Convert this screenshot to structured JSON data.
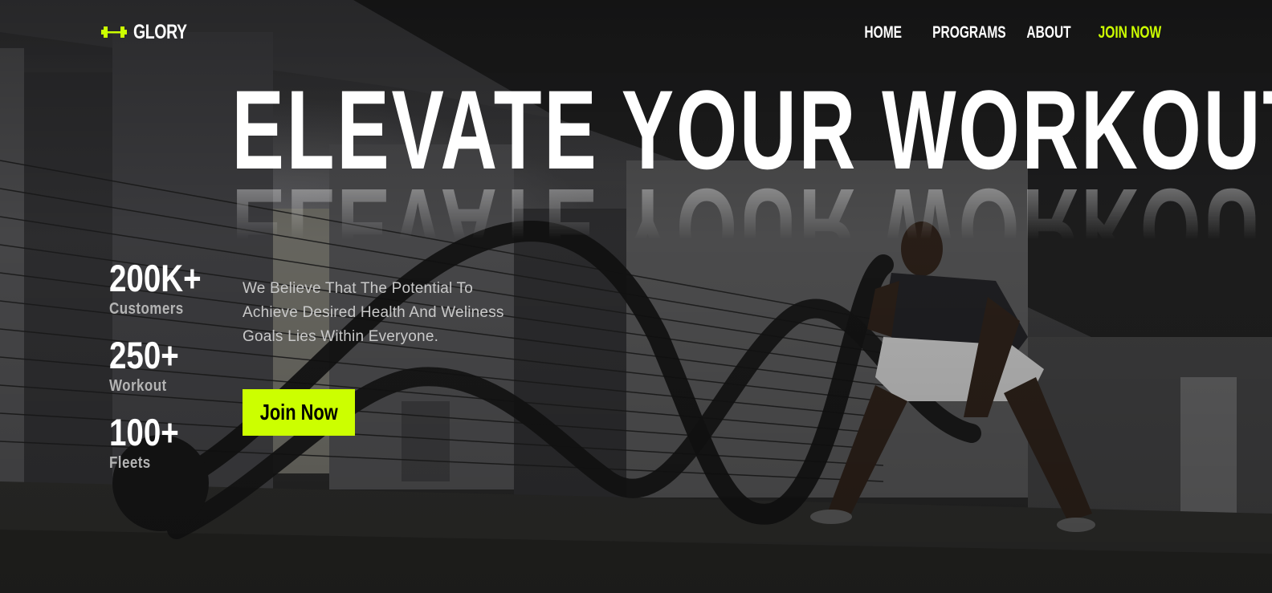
{
  "brand": {
    "name": "GLORY",
    "icon": "dumbbell-icon",
    "accent_color": "#ccff00"
  },
  "nav": {
    "items": [
      {
        "label": "HOME"
      },
      {
        "label": "PROGRAMS"
      },
      {
        "label": "ABOUT"
      },
      {
        "label": "JOIN NOW",
        "accent": true
      }
    ]
  },
  "hero": {
    "headline": "ELEVATE YOUR WORKOUT",
    "description": "We Believe That The Potential To Achieve Desired Health And Weliness Goals Lies Within Everyone.",
    "cta_label": "Join Now",
    "background": "battle-rope-workout-photo"
  },
  "stats": [
    {
      "value": "200K+",
      "label": "Customers"
    },
    {
      "value": "250+",
      "label": "Workout"
    },
    {
      "value": "100+",
      "label": "Fleets"
    }
  ]
}
